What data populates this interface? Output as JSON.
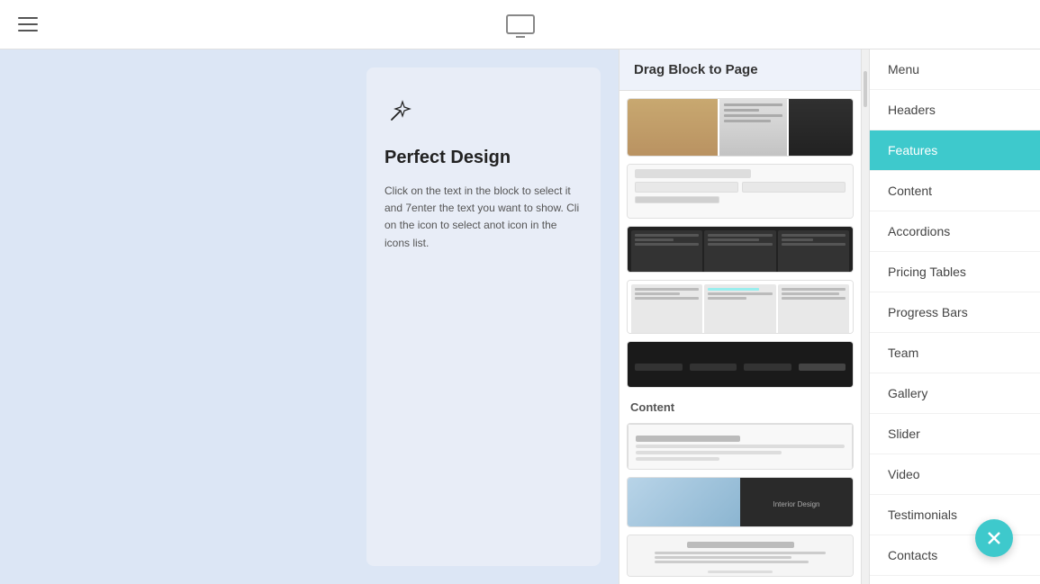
{
  "topbar": {
    "drag_block_label": "Drag Block to Page",
    "hamburger_label": "Menu toggle",
    "monitor_label": "Desktop view"
  },
  "preview": {
    "icon": "✦",
    "title": "Perfect Design",
    "text": "Click on the text in the block to select it and 7enter the text you want to show. Cli on the icon to select anot icon in the icons list."
  },
  "blocks_panel": {
    "header": "Drag Block to Page",
    "section_content_label": "Content"
  },
  "sidebar": {
    "items": [
      {
        "id": "menu",
        "label": "Menu",
        "active": false
      },
      {
        "id": "headers",
        "label": "Headers",
        "active": false
      },
      {
        "id": "features",
        "label": "Features",
        "active": true
      },
      {
        "id": "content",
        "label": "Content",
        "active": false
      },
      {
        "id": "accordions",
        "label": "Accordions",
        "active": false
      },
      {
        "id": "pricing-tables",
        "label": "Pricing Tables",
        "active": false
      },
      {
        "id": "progress-bars",
        "label": "Progress Bars",
        "active": false
      },
      {
        "id": "team",
        "label": "Team",
        "active": false
      },
      {
        "id": "gallery",
        "label": "Gallery",
        "active": false
      },
      {
        "id": "slider",
        "label": "Slider",
        "active": false
      },
      {
        "id": "video",
        "label": "Video",
        "active": false
      },
      {
        "id": "testimonials",
        "label": "Testimonials",
        "active": false
      },
      {
        "id": "contacts",
        "label": "Contacts",
        "active": false
      }
    ]
  },
  "close_button": {
    "label": "Close"
  }
}
